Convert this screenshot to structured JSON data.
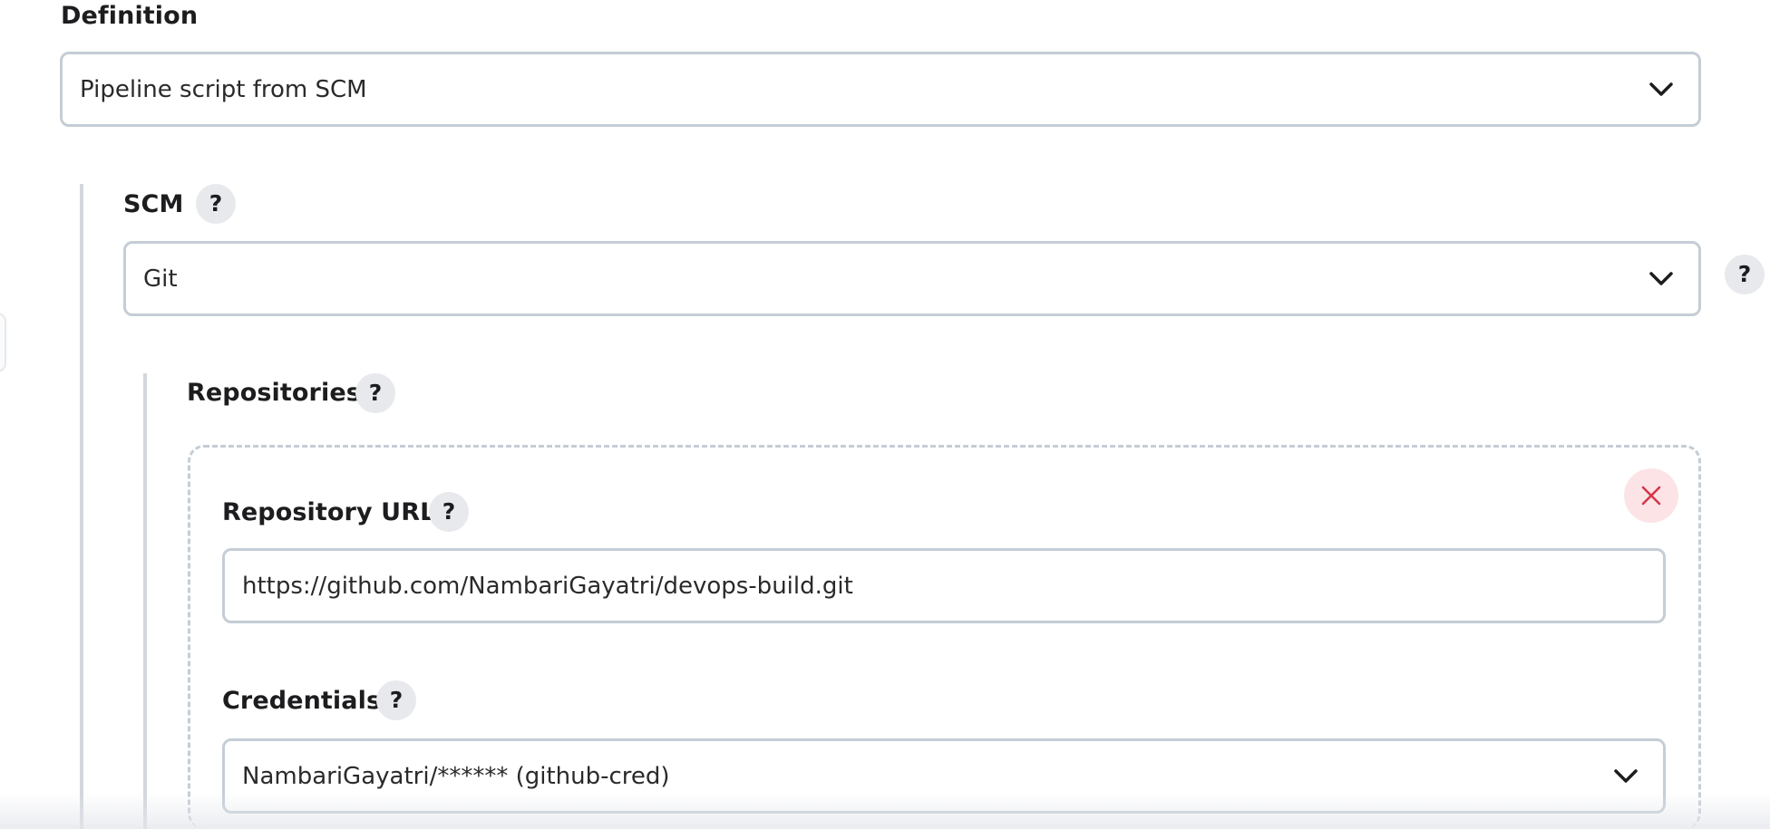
{
  "definition": {
    "label": "Definition",
    "selected": "Pipeline script from SCM"
  },
  "scm": {
    "label": "SCM",
    "help": "?",
    "selected": "Git",
    "side_help": "?"
  },
  "repositories": {
    "label": "Repositories",
    "help": "?",
    "repository_url": {
      "label": "Repository URL",
      "help": "?",
      "value": "https://github.com/NambariGayatri/devops-build.git"
    },
    "credentials": {
      "label": "Credentials",
      "help": "?",
      "selected": "NambariGayatri/****** (github-cred)"
    }
  },
  "icons": {
    "dropdown": "chevron-down-icon",
    "delete": "close-icon",
    "help": "question-icon"
  },
  "colors": {
    "border": "#c5cdd6",
    "help_bg": "#e8e9ec",
    "delete_bg": "#fce4e6",
    "delete_x": "#d6354a"
  }
}
